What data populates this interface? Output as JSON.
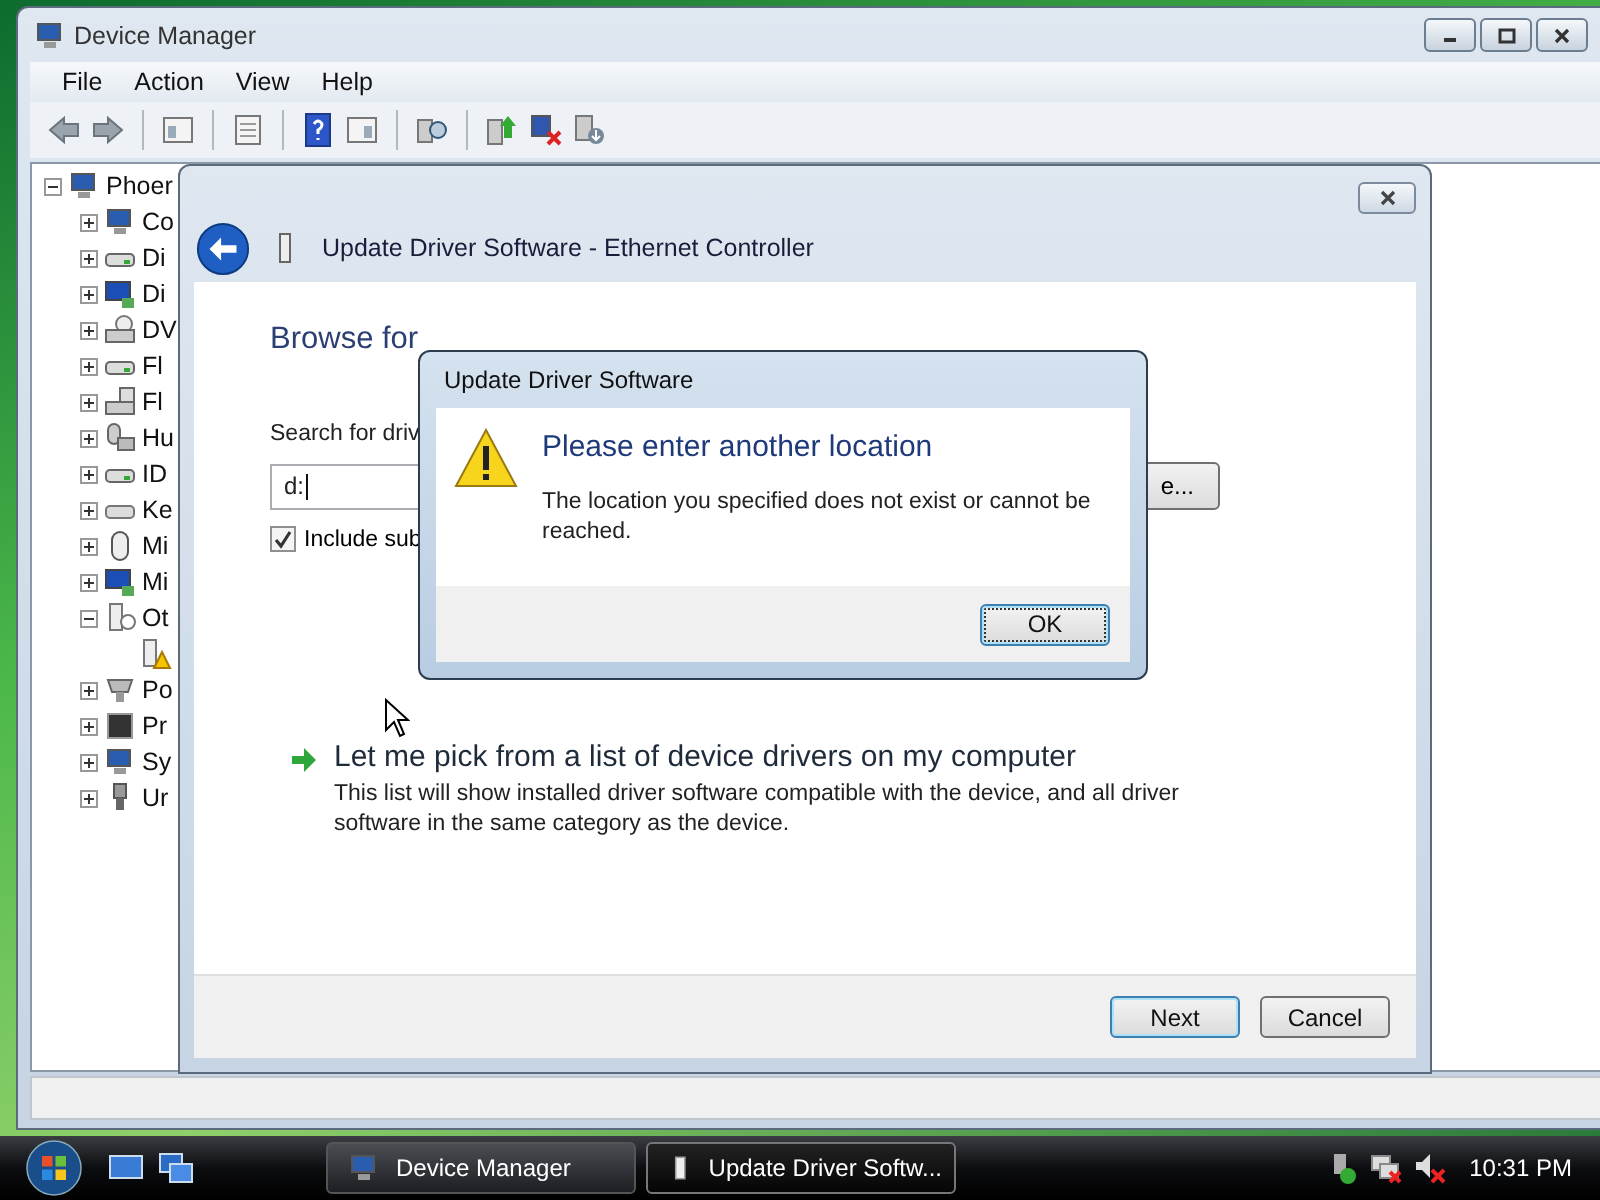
{
  "device_manager": {
    "title": "Device Manager",
    "menu": [
      "File",
      "Action",
      "View",
      "Help"
    ],
    "toolbar": [
      {
        "kind": "back"
      },
      {
        "kind": "forward"
      },
      {
        "kind": "separator"
      },
      {
        "kind": "tree-view"
      },
      {
        "kind": "separator"
      },
      {
        "kind": "properties"
      },
      {
        "kind": "separator"
      },
      {
        "kind": "help"
      },
      {
        "kind": "pane"
      },
      {
        "kind": "separator"
      },
      {
        "kind": "scan"
      },
      {
        "kind": "separator"
      },
      {
        "kind": "update"
      },
      {
        "kind": "uninstall"
      },
      {
        "kind": "disable"
      }
    ],
    "tree": {
      "label": "Phoer",
      "kind": "computer",
      "expanded": true,
      "children": [
        {
          "label": "Co",
          "kind": "computer",
          "expanded": false
        },
        {
          "label": "Di",
          "kind": "drive",
          "expanded": false
        },
        {
          "label": "Di",
          "kind": "display",
          "expanded": false
        },
        {
          "label": "DV",
          "kind": "dvd",
          "expanded": false
        },
        {
          "label": "Fl",
          "kind": "drive",
          "expanded": false
        },
        {
          "label": "Fl",
          "kind": "floppy",
          "expanded": false
        },
        {
          "label": "Hu",
          "kind": "hid",
          "expanded": false
        },
        {
          "label": "ID",
          "kind": "drive",
          "expanded": false
        },
        {
          "label": "Ke",
          "kind": "keyboard",
          "expanded": false
        },
        {
          "label": "Mi",
          "kind": "mouse",
          "expanded": false
        },
        {
          "label": "Mi",
          "kind": "display",
          "expanded": false
        },
        {
          "label": "Ot",
          "kind": "other",
          "expanded": true,
          "children": [
            {
              "kind": "warning-device"
            }
          ]
        },
        {
          "label": "Po",
          "kind": "port",
          "expanded": false
        },
        {
          "label": "Pr",
          "kind": "processor",
          "expanded": false
        },
        {
          "label": "Sy",
          "kind": "computer",
          "expanded": false
        },
        {
          "label": "Ur",
          "kind": "usb",
          "expanded": false
        }
      ]
    }
  },
  "wizard": {
    "title": "Update Driver Software - Ethernet Controller",
    "heading": "Browse for",
    "search_label": "Search for driv",
    "path_field": {
      "value": "d:"
    },
    "browse_button": "e...",
    "include_subfolders": {
      "label": "Include sub",
      "checked": true
    },
    "pick_option": {
      "title": "Let me pick from a list of device drivers on my computer",
      "description": "This list will show installed driver software compatible with the device, and all driver software in the same category as the device."
    },
    "buttons": [
      {
        "label": "Next",
        "default": true
      },
      {
        "label": "Cancel",
        "default": false
      }
    ]
  },
  "dialog": {
    "title": "Update Driver Software",
    "heading": "Please enter another location",
    "message": "The location you specified does not exist or cannot be reached.",
    "buttons": [
      {
        "label": "OK",
        "default": true
      }
    ]
  },
  "taskbar": {
    "quick_launch": [
      {
        "kind": "desktop"
      },
      {
        "kind": "switch"
      }
    ],
    "tasks": [
      {
        "label": "Device Manager",
        "kind": "device-manager",
        "selected": false
      },
      {
        "label": "Update Driver Softw...",
        "kind": "driver",
        "selected": true
      }
    ],
    "tray": [
      {
        "kind": "safely-remove"
      },
      {
        "kind": "network"
      },
      {
        "kind": "volume"
      }
    ],
    "clock": "10:31 PM"
  }
}
